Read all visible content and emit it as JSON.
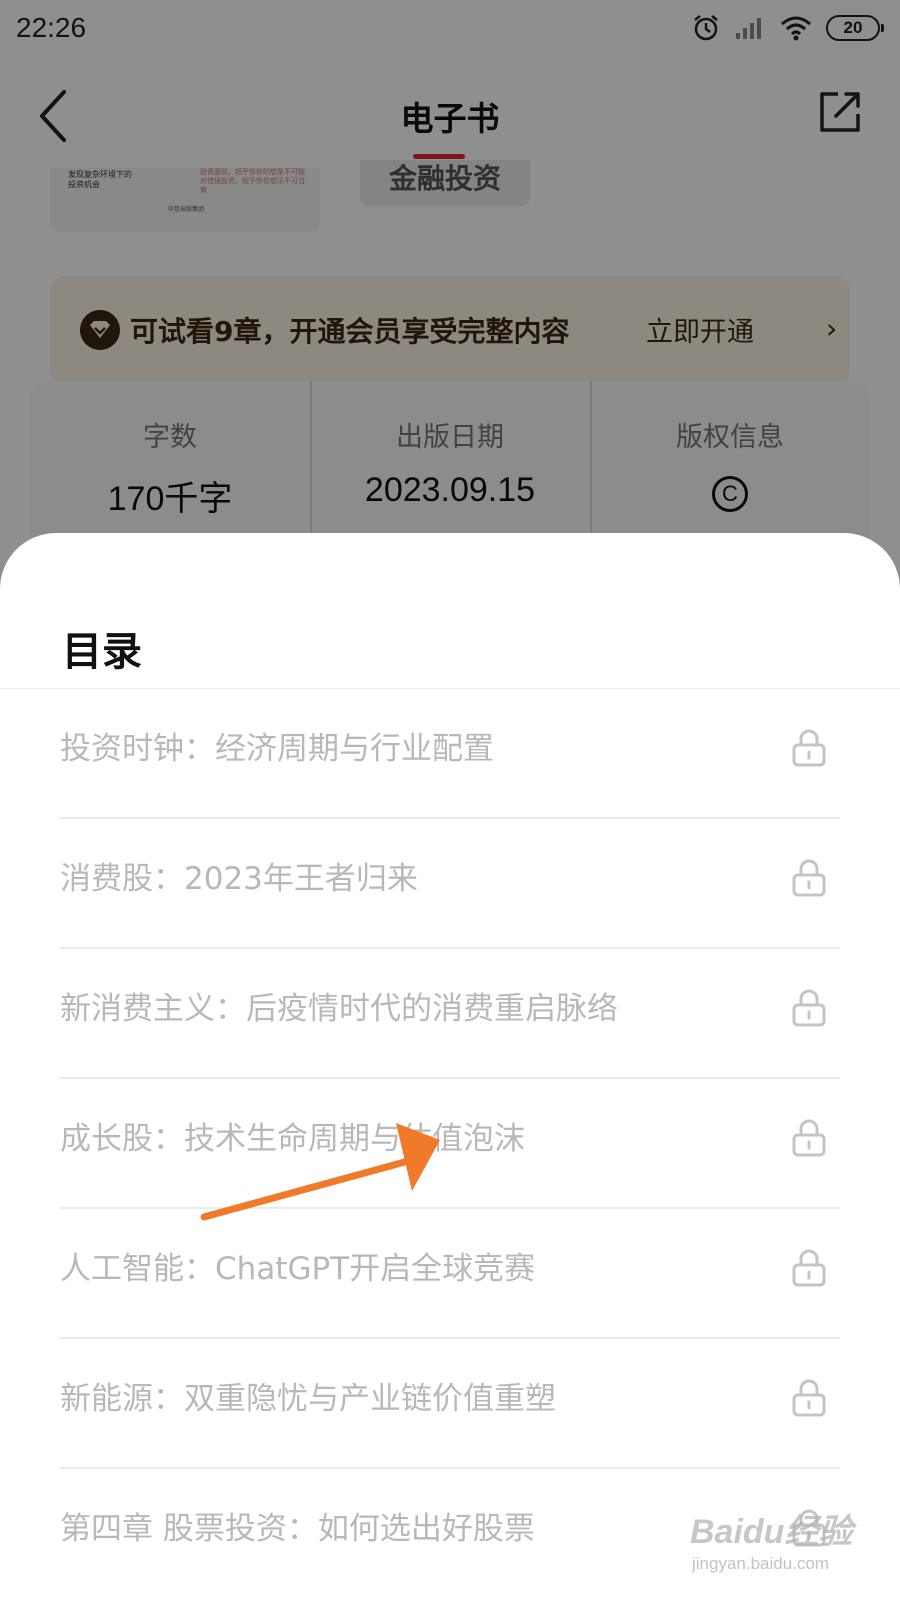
{
  "status_bar": {
    "time": "22:26",
    "battery": "20"
  },
  "nav": {
    "title": "电子书"
  },
  "book_cover": {
    "title_snippet": "发现复杂环境下的投资机会",
    "note_snippet": "投资面前，超乎你你的想象不可能对错误投资，超乎你你想法不可当做",
    "publisher": "中信出版集团"
  },
  "tag": {
    "label": "金融投资"
  },
  "member_banner": {
    "text": "可试看9章，开通会员享受完整内容",
    "link": "立即开通",
    "chevron": "›",
    "colors": {
      "background": "#fbf3e4",
      "text": "#3a2a12"
    }
  },
  "info": {
    "word_count_label": "字数",
    "word_count_value": "170千字",
    "pub_date_label": "出版日期",
    "pub_date_value": "2023.09.15",
    "copyright_label": "版权信息",
    "copyright_symbol": "C"
  },
  "toc": {
    "title": "目录",
    "items": [
      {
        "label": "投资时钟：经济周期与行业配置",
        "locked": true
      },
      {
        "label": "消费股：2023年王者归来",
        "locked": true
      },
      {
        "label": "新消费主义：后疫情时代的消费重启脉络",
        "locked": true
      },
      {
        "label": "成长股：技术生命周期与估值泡沫",
        "locked": true
      },
      {
        "label": "人工智能：ChatGPT开启全球竞赛",
        "locked": true
      },
      {
        "label": "新能源：双重隐忧与产业链价值重塑",
        "locked": true
      },
      {
        "label": "第四章 股票投资：如何选出好股票",
        "locked": true
      }
    ]
  },
  "annotation": {
    "arrow_color": "#f07a2a"
  },
  "watermark": {
    "main": "Baidu经验",
    "sub": "jingyan.baidu.com"
  }
}
